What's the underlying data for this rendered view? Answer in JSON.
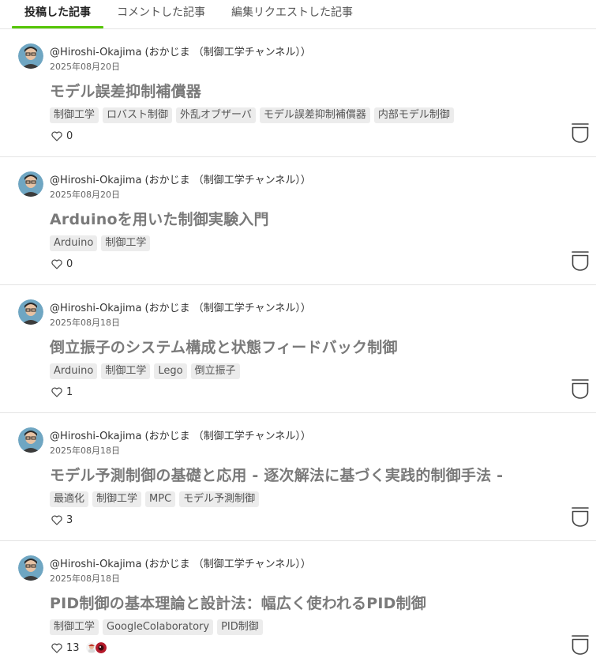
{
  "tabs": [
    {
      "label": "投稿した記事",
      "active": true
    },
    {
      "label": "コメントした記事",
      "active": false
    },
    {
      "label": "編集リクエストした記事",
      "active": false
    }
  ],
  "colors": {
    "accent": "#55c500",
    "title": "#7a7a7a",
    "tag_bg": "#ececec"
  },
  "articles": [
    {
      "author": "@Hiroshi-Okajima (おかじま （制御工学チャンネル））",
      "date": "2025年08月20日",
      "title": "モデル誤差抑制補償器",
      "tags": [
        "制御工学",
        "ロバスト制御",
        "外乱オブザーバ",
        "モデル誤差抑制補償器",
        "内部モデル制御"
      ],
      "likes": "0"
    },
    {
      "author": "@Hiroshi-Okajima (おかじま （制御工学チャンネル））",
      "date": "2025年08月20日",
      "title": "Arduinoを用いた制御実験入門",
      "tags": [
        "Arduino",
        "制御工学"
      ],
      "likes": "0"
    },
    {
      "author": "@Hiroshi-Okajima (おかじま （制御工学チャンネル））",
      "date": "2025年08月18日",
      "title": "倒立振子のシステム構成と状態フィードバック制御",
      "tags": [
        "Arduino",
        "制御工学",
        "Lego",
        "倒立振子"
      ],
      "likes": "1"
    },
    {
      "author": "@Hiroshi-Okajima (おかじま （制御工学チャンネル））",
      "date": "2025年08月18日",
      "title": "モデル予測制御の基礎と応用 - 逐次解法に基づく実践的制御手法 -",
      "tags": [
        "最適化",
        "制御工学",
        "MPC",
        "モデル予測制御"
      ],
      "likes": "3"
    },
    {
      "author": "@Hiroshi-Okajima (おかじま （制御工学チャンネル））",
      "date": "2025年08月18日",
      "title": "PID制御の基本理論と設計法：幅広く使われるPID制御",
      "tags": [
        "制御工学",
        "GoogleColaboratory",
        "PID制御"
      ],
      "likes": "13"
    }
  ]
}
